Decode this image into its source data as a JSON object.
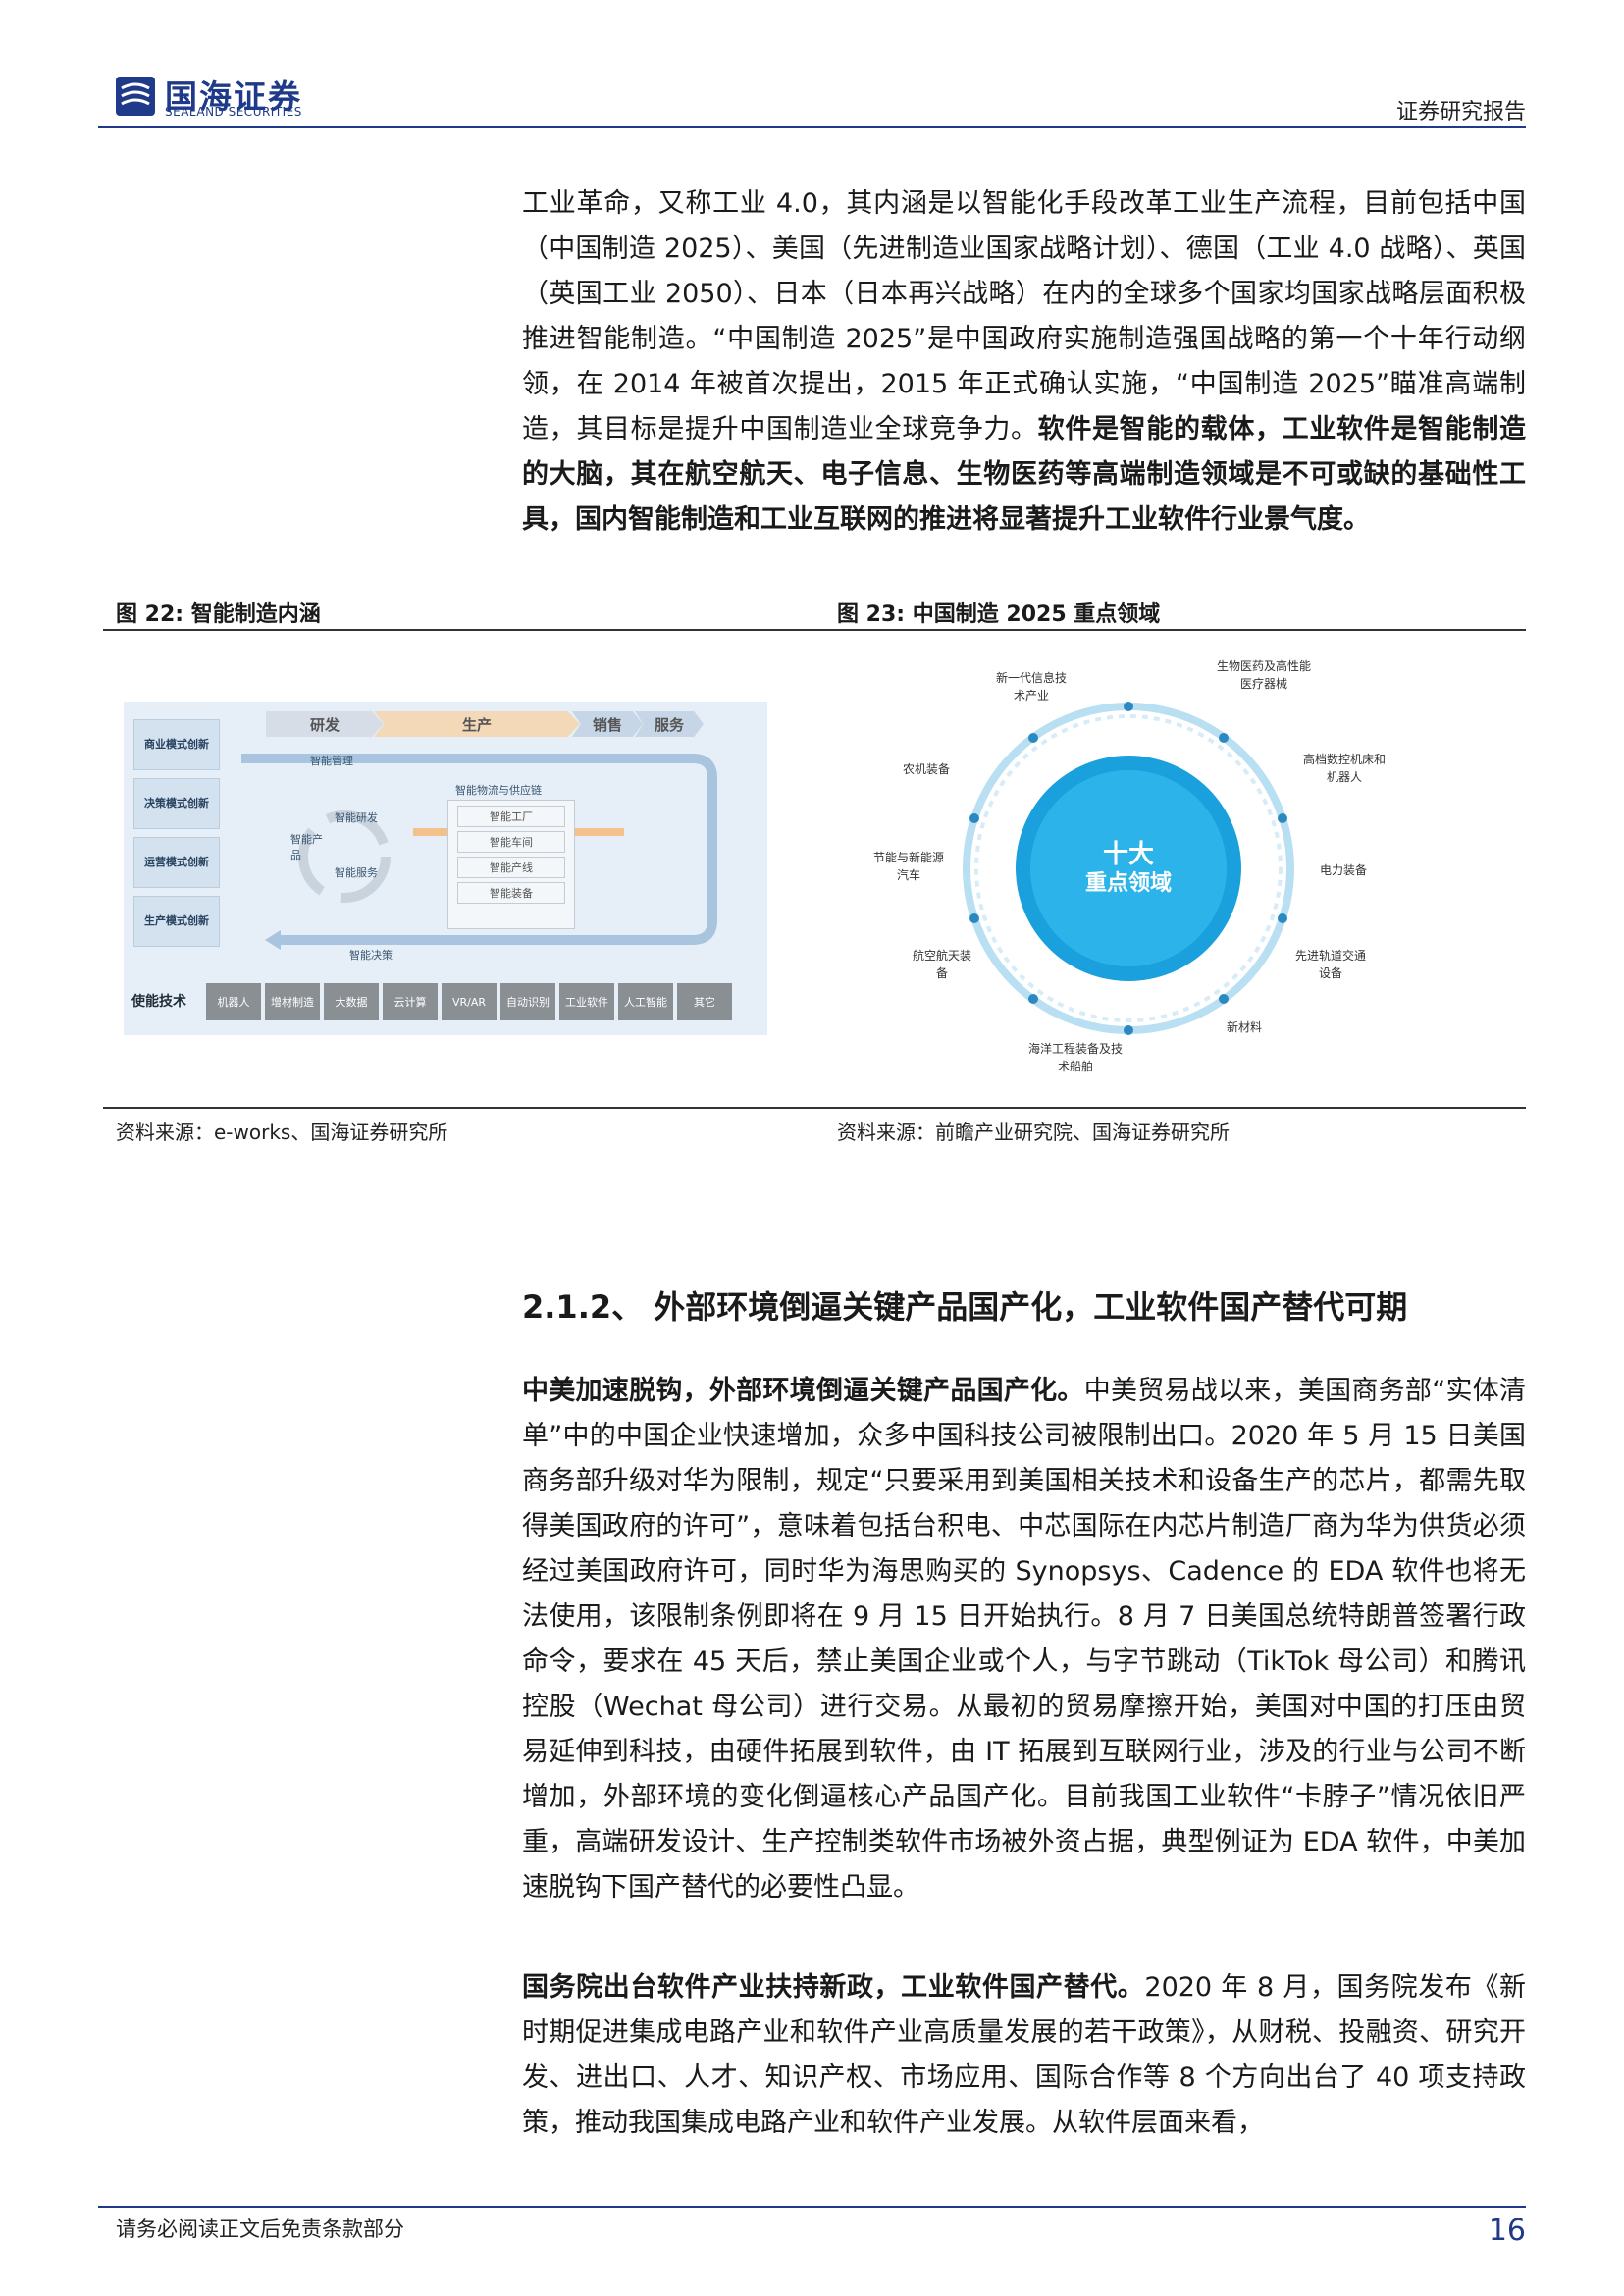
{
  "header": {
    "logo_cn": "国海证券",
    "logo_en": "SEALAND SECURITIES",
    "report_type": "证券研究报告"
  },
  "para1": {
    "normal": "工业革命，又称工业 4.0，其内涵是以智能化手段改革工业生产流程，目前包括中国（中国制造 2025）、美国（先进制造业国家战略计划）、德国（工业 4.0 战略）、英国（英国工业 2050）、日本（日本再兴战略）在内的全球多个国家均国家战略层面积极推进智能制造。“中国制造 2025”是中国政府实施制造强国战略的第一个十年行动纲领，在 2014 年被首次提出，2015 年正式确认实施，“中国制造 2025”瞄准高端制造，其目标是提升中国制造业全球竞争力。",
    "bold": "软件是智能的载体，工业软件是智能制造的大脑，其在航空航天、电子信息、生物医药等高端制造领域是不可或缺的基础性工具，国内智能制造和工业互联网的推进将显著提升工业软件行业景气度。"
  },
  "figure22": {
    "caption": "图 22:  智能制造内涵",
    "source": "资料来源：e-works、国海证券研究所",
    "stages": [
      "研发",
      "生产",
      "销售",
      "服务"
    ],
    "row_labels": [
      "商业模式创新",
      "决策模式创新",
      "运营模式创新",
      "生产模式创新"
    ],
    "mgmt": "智能管理",
    "center_items": [
      "智能研发",
      "智能产品",
      "智能服务"
    ],
    "supply_chain": "智能物流与供应链",
    "factory_items": [
      "智能工厂",
      "智能车间",
      "智能产线",
      "智能装备"
    ],
    "decision": "智能决策",
    "tech_label": "使能技术",
    "tech_items": [
      "机器人",
      "增材制造",
      "大数据",
      "云计算",
      "VR/AR",
      "自动识别",
      "工业软件",
      "人工智能",
      "其它"
    ]
  },
  "figure23": {
    "caption": "图 23:  中国制造 2025 重点领域",
    "source": "资料来源：前瞻产业研究院、国海证券研究所",
    "center_title": "十大",
    "center_sub": "重点领域",
    "domains": [
      "新一代信息技术产业",
      "生物医药及高性能医疗器械",
      "高档数控机床和机器人",
      "电力装备",
      "先进轨道交通设备",
      "新材料",
      "海洋工程装备及技术船舶",
      "航空航天装备",
      "节能与新能源汽车",
      "农机装备"
    ]
  },
  "section": {
    "heading": "2.1.2、  外部环境倒逼关键产品国产化，工业软件国产替代可期"
  },
  "para2": {
    "bold": "中美加速脱钩，外部环境倒逼关键产品国产化。",
    "normal": "中美贸易战以来，美国商务部“实体清单”中的中国企业快速增加，众多中国科技公司被限制出口。2020 年 5 月 15 日美国商务部升级对华为限制，规定“只要采用到美国相关技术和设备生产的芯片，都需先取得美国政府的许可”，意味着包括台积电、中芯国际在内芯片制造厂商为华为供货必须经过美国政府许可，同时华为海思购买的 Synopsys、Cadence 的 EDA 软件也将无法使用，该限制条例即将在 9 月 15 日开始执行。8 月 7 日美国总统特朗普签署行政命令，要求在 45 天后，禁止美国企业或个人，与字节跳动（TikTok 母公司）和腾讯控股（Wechat 母公司）进行交易。从最初的贸易摩擦开始，美国对中国的打压由贸易延伸到科技，由硬件拓展到软件，由 IT 拓展到互联网行业，涉及的行业与公司不断增加，外部环境的变化倒逼核心产品国产化。目前我国工业软件“卡脖子”情况依旧严重，高端研发设计、生产控制类软件市场被外资占据，典型例证为 EDA 软件，中美加速脱钩下国产替代的必要性凸显。"
  },
  "para3": {
    "bold": "国务院出台软件产业扶持新政，工业软件国产替代。",
    "normal": "2020 年 8 月，国务院发布《新时期促进集成电路产业和软件产业高质量发展的若干政策》，从财税、投融资、研究开发、进出口、人才、知识产权、市场应用、国际合作等 8 个方向出台了 40 项支持政策，推动我国集成电路产业和软件产业发展。从软件层面来看，"
  },
  "footer": {
    "disclaimer": "请务必阅读正文后免责条款部分",
    "page": "16"
  },
  "colors": {
    "brand": "#1f3a8a",
    "circle_center": "#1aa0dc"
  }
}
